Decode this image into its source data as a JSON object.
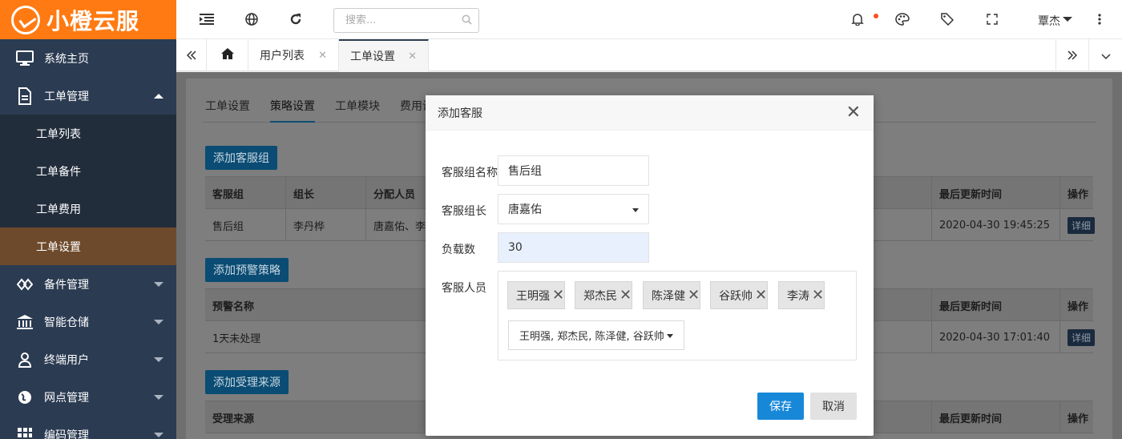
{
  "brand": {
    "name": "小橙云服",
    "color": "#ff7a12"
  },
  "sidebar": {
    "items": [
      {
        "label": "系统主页",
        "icon": "monitor-icon"
      },
      {
        "label": "工单管理",
        "icon": "document-icon",
        "expanded": true,
        "children": [
          {
            "label": "工单列表"
          },
          {
            "label": "工单备件"
          },
          {
            "label": "工单费用"
          },
          {
            "label": "工单设置",
            "active": true
          }
        ]
      },
      {
        "label": "备件管理",
        "icon": "parts-icon"
      },
      {
        "label": "智能仓储",
        "icon": "warehouse-icon"
      },
      {
        "label": "终端用户",
        "icon": "user-icon"
      },
      {
        "label": "网点管理",
        "icon": "globe-icon"
      },
      {
        "label": "编码管理",
        "icon": "grid-icon"
      }
    ]
  },
  "topbar": {
    "search_placeholder": "搜索...",
    "user": "覃杰"
  },
  "tabs": [
    {
      "label": "用户列表"
    },
    {
      "label": "工单设置",
      "active": true
    }
  ],
  "subtabs": [
    "工单设置",
    "策略设置",
    "工单模块",
    "费用设"
  ],
  "sections": {
    "group": {
      "add_label": "添加客服组",
      "headers": [
        "客服组",
        "组长",
        "分配人员",
        "最后更新时间",
        "操作"
      ],
      "rows": [
        {
          "c1": "售后组",
          "c2": "李丹桦",
          "c3": "唐嘉佑、李",
          "time": "2020-04-30 19:45:25",
          "action": "详细"
        }
      ]
    },
    "warning": {
      "add_label": "添加预警策略",
      "headers": [
        "预警名称",
        "最后更新时间",
        "操作"
      ],
      "rows": [
        {
          "c1": "1天未处理",
          "time": "2020-04-30 17:01:40",
          "action": "详细"
        }
      ]
    },
    "source": {
      "add_label": "添加受理来源",
      "headers": [
        "受理来源",
        "最后更新时间",
        "操作"
      ]
    }
  },
  "modal": {
    "title": "添加客服",
    "fields": {
      "group_name": {
        "label": "客服组名称",
        "value": "售后组"
      },
      "leader": {
        "label": "客服组长",
        "value": "唐嘉佑"
      },
      "load": {
        "label": "负载数",
        "value": "30"
      },
      "staff": {
        "label": "客服人员"
      }
    },
    "staff_chips": [
      "王明强",
      "郑杰民",
      "陈泽健",
      "谷跃帅",
      "李涛"
    ],
    "staff_select_text": "王明强, 郑杰民, 陈泽健, 谷跃帅",
    "save_label": "保存",
    "cancel_label": "取消"
  }
}
